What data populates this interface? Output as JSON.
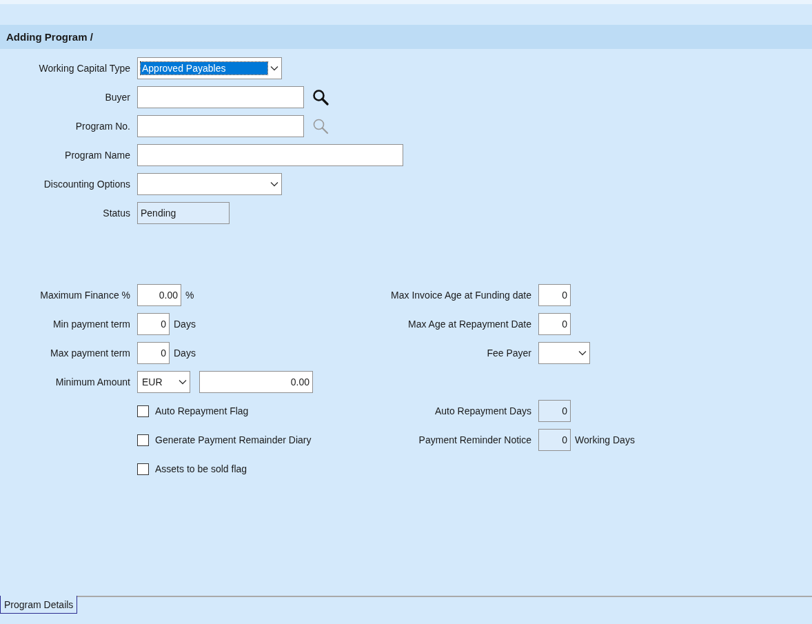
{
  "header": {
    "title": "Adding Program /"
  },
  "top_fields": [
    {
      "label": "Working Capital Type",
      "kind": "dropdown",
      "value": "Approved Payables",
      "highlighted": true
    },
    {
      "label": "Buyer",
      "kind": "lookup",
      "search_enabled": true
    },
    {
      "label": "Program No.",
      "kind": "lookup",
      "search_enabled": false
    },
    {
      "label": "Program Name",
      "kind": "wide_text"
    },
    {
      "label": "Discounting Options",
      "kind": "dropdown",
      "highlighted": false
    },
    {
      "label": "Status",
      "kind": "readonly",
      "value": "Pending"
    }
  ],
  "detail_rows": [
    {
      "left": {
        "label": "Maximum Finance %",
        "kind": "decimal",
        "value": "0.00",
        "unit": "%"
      },
      "right": {
        "label": "Max Invoice Age at Funding date",
        "kind": "integer",
        "value": "0",
        "readonly": false
      }
    },
    {
      "left": {
        "label": "Min payment term",
        "kind": "integer",
        "value": "0",
        "unit": "Days"
      },
      "right": {
        "label": "Max Age at Repayment Date",
        "kind": "integer",
        "value": "0",
        "readonly": false
      }
    },
    {
      "left": {
        "label": "Max payment term",
        "kind": "integer",
        "value": "0",
        "unit": "Days"
      },
      "right": {
        "label": "Fee Payer",
        "kind": "dropdown"
      }
    },
    {
      "left": {
        "label": "Minimum Amount",
        "kind": "currency_amount",
        "currency": "EUR",
        "value": "0.00"
      }
    },
    {
      "left": {
        "label": "Auto Repayment Flag",
        "kind": "checkbox",
        "checked": false
      },
      "right": {
        "label": "Auto Repayment Days",
        "kind": "integer",
        "value": "0",
        "readonly": true
      }
    },
    {
      "left": {
        "label": "Generate Payment Remainder Diary",
        "kind": "checkbox",
        "checked": false
      },
      "right": {
        "label": "Payment Reminder Notice",
        "kind": "integer",
        "value": "0",
        "readonly": true,
        "unit": "Working Days"
      }
    },
    {
      "left": {
        "label": "Assets to be sold flag",
        "kind": "checkbox",
        "checked": false
      }
    }
  ],
  "tabs": [
    {
      "label": "Program Details",
      "selected": true
    }
  ]
}
